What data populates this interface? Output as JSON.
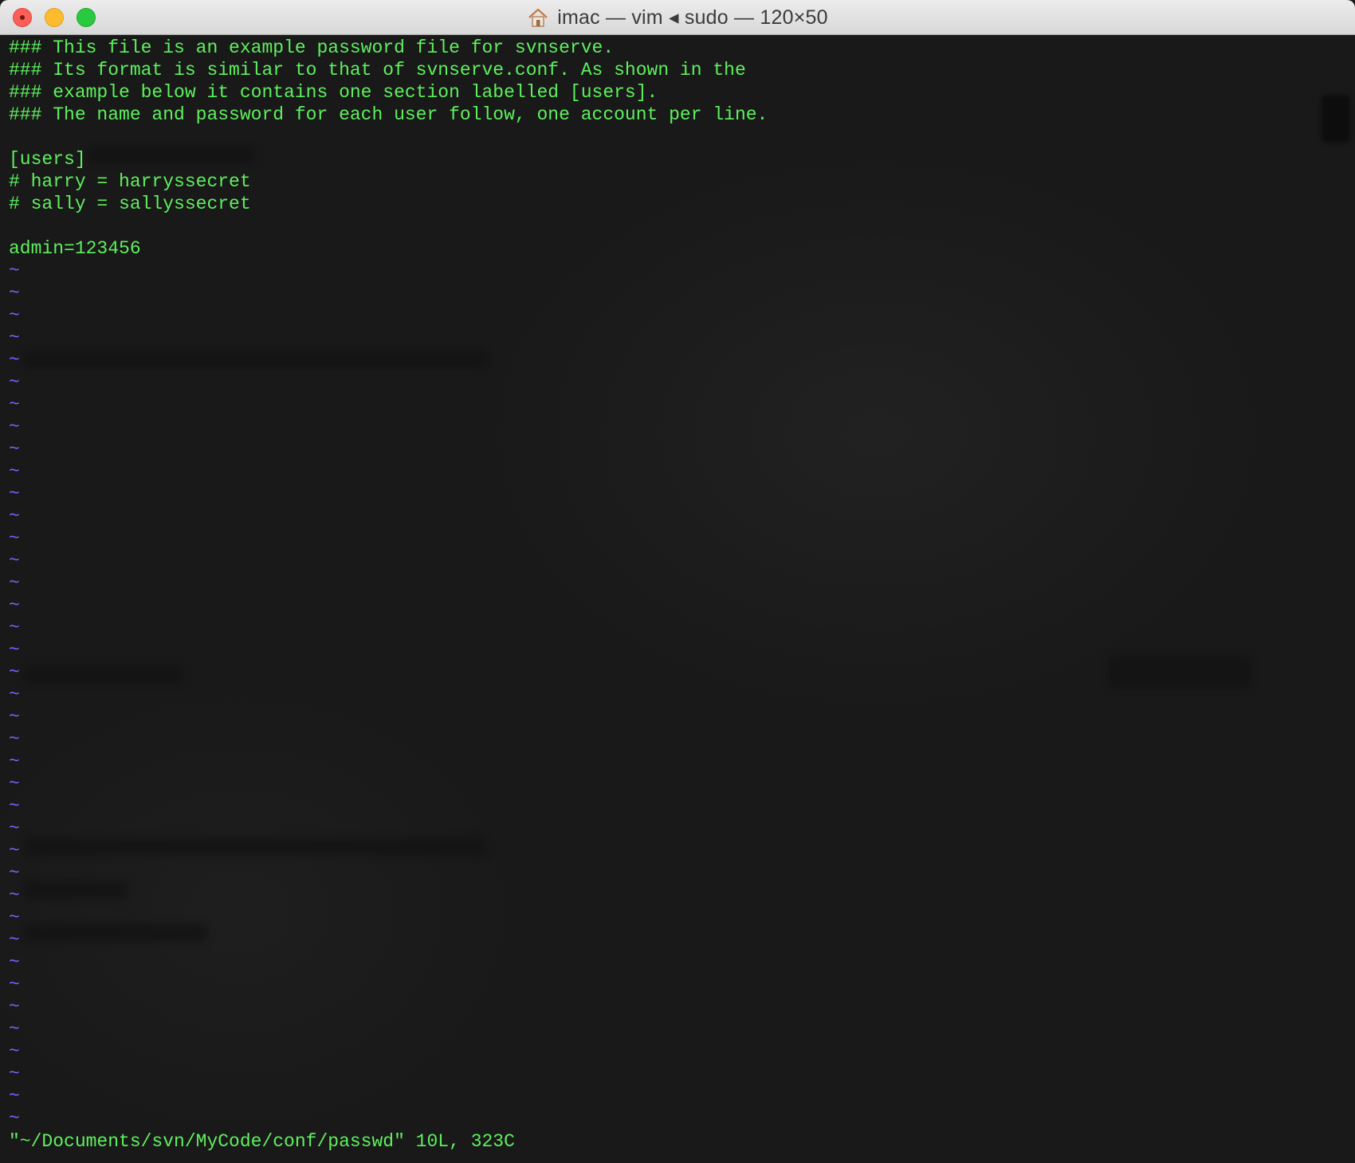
{
  "window": {
    "title": "imac — vim ◂ sudo — 120×50"
  },
  "editor": {
    "lines": [
      "### This file is an example password file for svnserve.",
      "### Its format is similar to that of svnserve.conf. As shown in the",
      "### example below it contains one section labelled [users].",
      "### The name and password for each user follow, one account per line.",
      "",
      "[users]",
      "# harry = harryssecret",
      "# sally = sallyssecret",
      "",
      "admin=123456"
    ],
    "tilde_char": "~",
    "status_line": "\"~/Documents/svn/MyCode/conf/passwd\" 10L, 323C"
  },
  "colors": {
    "text": "#5ef05e",
    "tilde": "#8a5cff",
    "background": "#191919"
  }
}
